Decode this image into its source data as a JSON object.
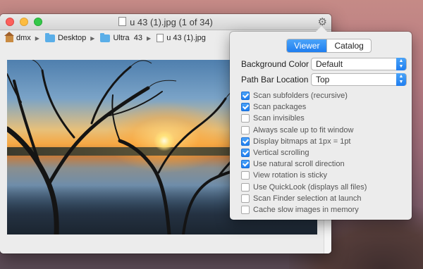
{
  "window": {
    "title": "u 43 (1).jpg (1 of 34)"
  },
  "pathbar": {
    "items": [
      "dmx",
      "Desktop",
      "Ultra  43",
      "u 43 (1).jpg"
    ]
  },
  "panel": {
    "tabs": [
      {
        "label": "Viewer",
        "active": true
      },
      {
        "label": "Catalog",
        "active": false
      }
    ],
    "background_color": {
      "label": "Background Color",
      "value": "Default"
    },
    "path_bar_location": {
      "label": "Path Bar Location",
      "value": "Top"
    },
    "options": [
      {
        "label": "Scan subfolders (recursive)",
        "checked": true
      },
      {
        "label": "Scan packages",
        "checked": true
      },
      {
        "label": "Scan invisibles",
        "checked": false
      },
      {
        "label": "Always scale up to fit window",
        "checked": false
      },
      {
        "label": "Display bitmaps at 1px = 1pt",
        "checked": true
      },
      {
        "label": "Vertical scrolling",
        "checked": true
      },
      {
        "label": "Use natural scroll direction",
        "checked": true
      },
      {
        "label": "View rotation is sticky",
        "checked": false
      },
      {
        "label": "Use QuickLook (displays all files)",
        "checked": false
      },
      {
        "label": "Scan Finder selection at launch",
        "checked": false
      },
      {
        "label": "Cache slow images in memory",
        "checked": false
      }
    ]
  },
  "colors": {
    "accent": "#1f7ef0",
    "close": "#fc605c",
    "minimize": "#fdbc40",
    "maximize": "#34c84a"
  }
}
